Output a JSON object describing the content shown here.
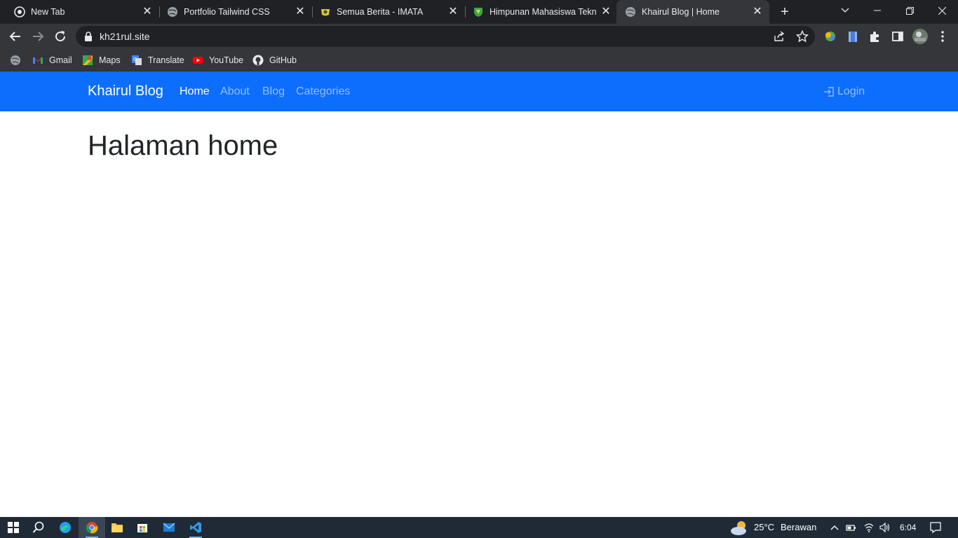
{
  "browser": {
    "tabs": [
      {
        "title": "New Tab",
        "active": false
      },
      {
        "title": "Portfolio Tailwind CSS",
        "active": false
      },
      {
        "title": "Semua Berita - IMATA",
        "active": false
      },
      {
        "title": "Himpunan Mahasiswa Teknik",
        "active": false
      },
      {
        "title": "Khairul Blog | Home",
        "active": true
      }
    ],
    "new_tab_symbol": "+",
    "close_symbol": "✕",
    "url": "kh21rul.site",
    "bookmarks": [
      {
        "label": "Gmail",
        "icon": "gmail-icon"
      },
      {
        "label": "Maps",
        "icon": "maps-icon"
      },
      {
        "label": "Translate",
        "icon": "translate-icon"
      },
      {
        "label": "YouTube",
        "icon": "youtube-icon"
      },
      {
        "label": "GitHub",
        "icon": "github-icon"
      }
    ]
  },
  "site": {
    "brand": "Khairul Blog",
    "nav": [
      {
        "label": "Home",
        "active": true
      },
      {
        "label": "About",
        "active": false
      },
      {
        "label": "Blog",
        "active": false
      },
      {
        "label": "Categories",
        "active": false
      }
    ],
    "login": "Login",
    "heading": "Halaman home",
    "navbar_color": "#0d6efd"
  },
  "taskbar": {
    "weather_temp": "25°C",
    "weather_desc": "Berawan",
    "time": "6:04"
  }
}
